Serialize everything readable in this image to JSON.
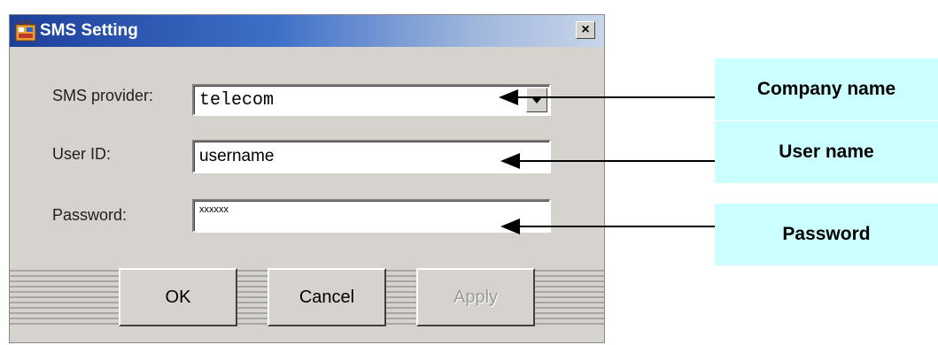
{
  "dialog": {
    "title": "SMS Setting",
    "close_label": "×",
    "fields": {
      "provider_label": "SMS provider:",
      "provider_value": "telecom",
      "user_label": "User ID:",
      "user_value": "username",
      "password_label": "Password:",
      "password_value": "xxxxxx"
    },
    "buttons": {
      "ok": "OK",
      "cancel": "Cancel",
      "apply": "Apply"
    }
  },
  "callouts": {
    "company": "Company name",
    "user": "User name",
    "password": "Password"
  },
  "colors": {
    "callout_bg": "#ccffff",
    "titlebar_start": "#1c3f9a",
    "dialog_bg": "#d6d3ce"
  }
}
